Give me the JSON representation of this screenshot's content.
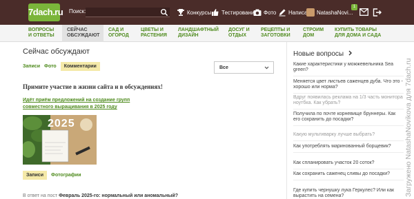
{
  "header": {
    "logo_text": "7dach.ru",
    "search_label": "Поиск:",
    "items": [
      {
        "label": "Конкурсы",
        "icon": "trophy-icon"
      },
      {
        "label": "Тестирования",
        "icon": "thumbs-up-icon"
      },
      {
        "label": "Фото",
        "icon": "camera-icon"
      },
      {
        "label": "Написать",
        "icon": "pencil-icon"
      }
    ],
    "user_name": "NatashaNovi...",
    "notification_count": "1"
  },
  "nav": {
    "items": [
      {
        "line1": "ВОПРОСЫ",
        "line2": "И ОТВЕТЫ",
        "active": false
      },
      {
        "line1": "СЕЙЧАС",
        "line2": "ОБСУЖДАЮТ",
        "active": true
      },
      {
        "line1": "САД И",
        "line2": "ОГОРОД",
        "active": false
      },
      {
        "line1": "ЦВЕТЫ И",
        "line2": "РАСТЕНИЯ",
        "active": false
      },
      {
        "line1": "ЛАНДШАФТНЫЙ",
        "line2": "ДИЗАЙН",
        "active": false
      },
      {
        "line1": "ДОСУГ И",
        "line2": "ОТДЫХ",
        "active": false
      },
      {
        "line1": "РЕЦЕПТЫ И",
        "line2": "ЗАГОТОВКИ",
        "active": false
      },
      {
        "line1": "СТРОИМ",
        "line2": "ДОМ",
        "active": false
      },
      {
        "line1": "КУПИТЬ ТОВАРЫ",
        "line2": "ДЛЯ ДОМА И САДА",
        "active": false
      }
    ]
  },
  "main": {
    "title": "Сейчас обсуждают",
    "subtabs": [
      "Записи",
      "Фото",
      "Комментарии"
    ],
    "active_subtab": "Комментарии",
    "filter_value": "Все",
    "intro": "Примите участие в жизни сайта и в обсуждениях!",
    "post_link": "Идёт приём предложений на создание групп совместного выращивания в 2025 году",
    "image_caption": "2025",
    "bottom_tabs": [
      "Записи",
      "Фотографии"
    ],
    "active_bottom_tab": "Записи",
    "reply_prefix": "В ответ на пост",
    "reply_title": "Февраль 2025-го: нормальный или аномальный?"
  },
  "sidebar": {
    "title": "Новые вопросы",
    "items": [
      {
        "text": "Какие характеристики у можжевельника Sea green?",
        "muted": false
      },
      {
        "text": "Меняется цвет листьев саженцев дуба. Что это - хорошо или норма?",
        "muted": false
      },
      {
        "text": "Вдруг появилась реклама на 1/3 часть монитора ноутбка. Как убрать?",
        "muted": true
      },
      {
        "text": "Получила по почте корневище бруннеры. Как его сохранить до посадки?",
        "muted": false
      },
      {
        "text": "Какую мультиварку лучше выбрать?",
        "muted": true
      },
      {
        "text": "Как употреблять маринованный борщевик?",
        "muted": false
      },
      {
        "text": "Как спланировать участок 20 соток?",
        "muted": false
      },
      {
        "text": "Как сохранить саженец сливы до посадки?",
        "muted": false
      },
      {
        "text": "Где купить чернушку лука Геркулес? Или как вырастить на семена?",
        "muted": false
      }
    ]
  },
  "watermark": "Загружено NatashaNovikova для 7dach.ru",
  "colors": {
    "header_bg": "#4a2c29",
    "accent_green": "#4f8b1e",
    "logo_green": "#7bb53a",
    "highlight": "#f4e9a8"
  }
}
